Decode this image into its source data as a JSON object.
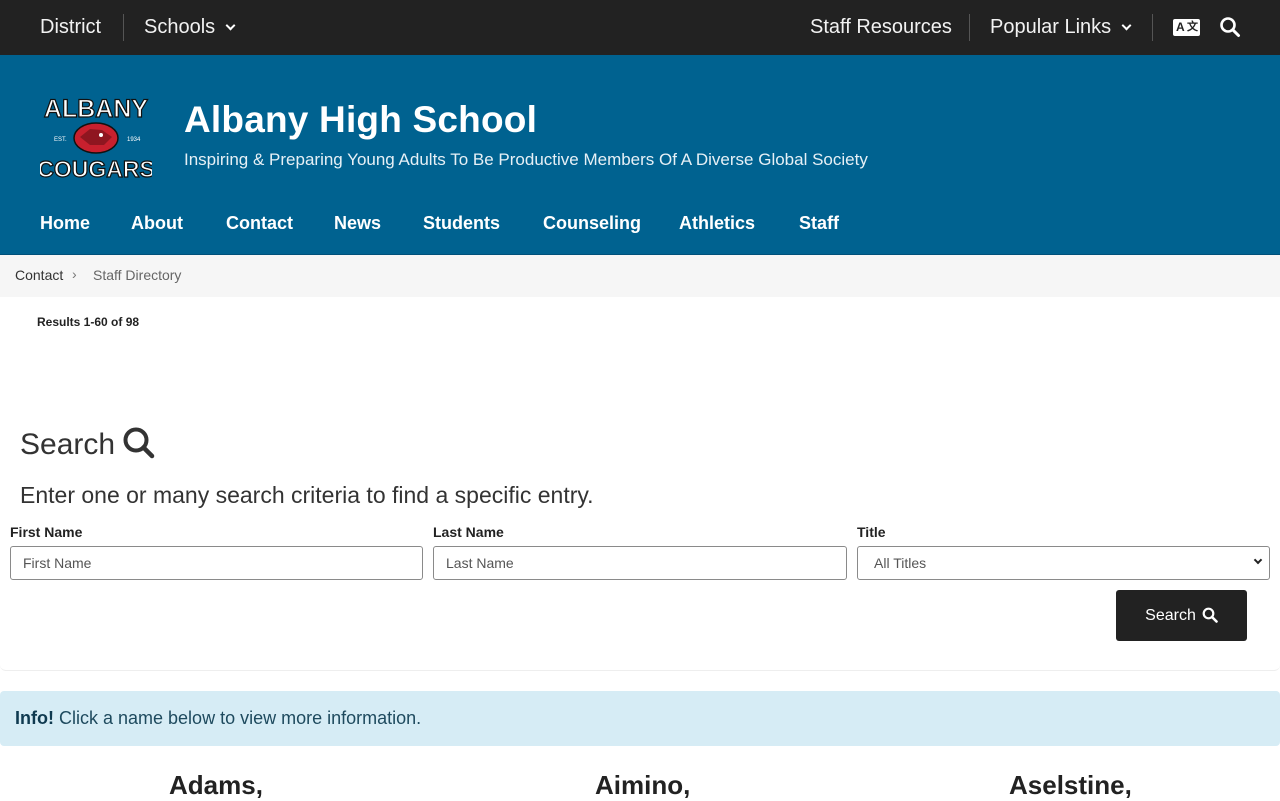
{
  "topbar": {
    "district": "District",
    "schools": "Schools",
    "staff_resources": "Staff Resources",
    "popular_links": "Popular Links",
    "translate_icon_text": "A文"
  },
  "header": {
    "school_name": "Albany High School",
    "tagline": "Inspiring & Preparing Young Adults To Be Productive Members Of A Diverse Global Society",
    "logo_text_top": "ALBANY",
    "logo_text_bottom": "COUGARS",
    "logo_est": "EST.",
    "logo_year": "1934",
    "colors": {
      "header_bg": "#006290",
      "topbar_bg": "#222222"
    }
  },
  "nav": {
    "items": [
      "Home",
      "About",
      "Contact",
      "News",
      "Students",
      "Counseling",
      "Athletics",
      "Staff"
    ]
  },
  "breadcrumb": {
    "parent": "Contact",
    "current": "Staff Directory"
  },
  "results_text": "Results 1-60 of 98",
  "search": {
    "title": "Search",
    "subtitle": "Enter one or many search criteria to find a specific entry.",
    "first_name_label": "First Name",
    "first_name_placeholder": "First Name",
    "last_name_label": "Last Name",
    "last_name_placeholder": "Last Name",
    "title_label": "Title",
    "title_selected": "All Titles",
    "button_label": "Search"
  },
  "info": {
    "strong": "Info!",
    "text": "Click a name below to view more information."
  },
  "staff": [
    "Adams,",
    "Aimino,",
    "Aselstine,"
  ]
}
